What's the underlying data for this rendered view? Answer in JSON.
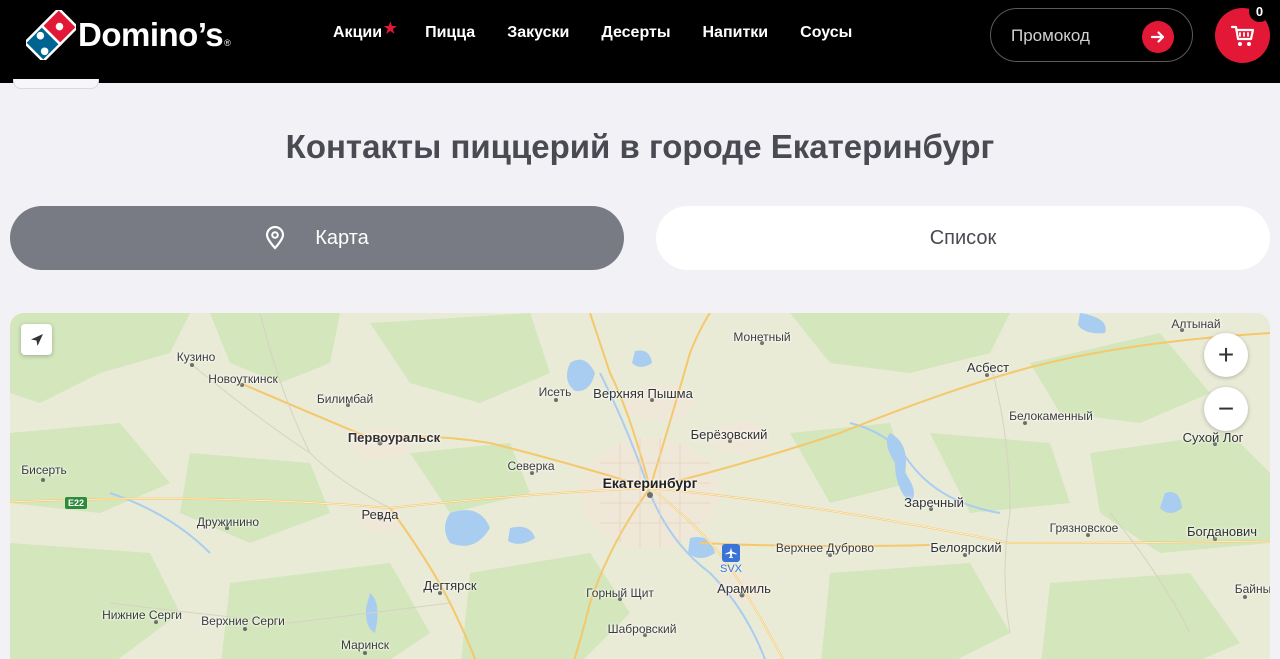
{
  "header": {
    "logo_text": "Domino’s",
    "logo_reg": "®",
    "nav": [
      "Акции",
      "Пицца",
      "Закуски",
      "Десерты",
      "Напитки",
      "Соусы"
    ],
    "promo_placeholder": "Промокод",
    "cart_count": "0"
  },
  "page": {
    "title": "Контакты пиццерий в городе Екатеринбург"
  },
  "view_toggle": {
    "map_label": "Карта",
    "list_label": "Список",
    "active": "map"
  },
  "map": {
    "labels": {
      "kuzino": "Кузино",
      "novoutkinsk": "Новоуткинск",
      "bilimbay": "Билимбай",
      "pervouralsk": "Первоуральск",
      "bisert": "Бисерть",
      "druzhinino": "Дружинино",
      "revda": "Ревда",
      "degtyarsk": "Дегтярск",
      "nizhnie_sergi": "Нижние Серги",
      "verkhnie_sergi": "Верхние Серги",
      "marinsk": "Маринск",
      "iset": "Исеть",
      "verkhnyaya_pyshma": "Верхняя Пышма",
      "berezovsky": "Берёзовский",
      "severka": "Северка",
      "ekaterinburg": "Екатеринбург",
      "monetny": "Монетный",
      "gorny_shchit": "Горный Щит",
      "shabrovsky": "Шабровский",
      "aramil": "Арамиль",
      "verkhnee_dubrovo": "Верхнее Дуброво",
      "asbest": "Асбест",
      "belokamenny": "Белокаменный",
      "zarechny": "Заречный",
      "beloyarsky": "Белоярский",
      "gryaznovskoe": "Грязновское",
      "altynay": "Алтынай",
      "sukhoy_log": "Сухой Лог",
      "bogdanovich": "Богданович",
      "bainy": "Байны"
    },
    "road": "E22",
    "airport_code": "SVX",
    "zoom_in": "+",
    "zoom_out": "−"
  },
  "colors": {
    "brand_red": "#e31837",
    "header_bg": "#000000",
    "toggle_active": "#787a84",
    "page_bg": "#f1f1f6"
  }
}
